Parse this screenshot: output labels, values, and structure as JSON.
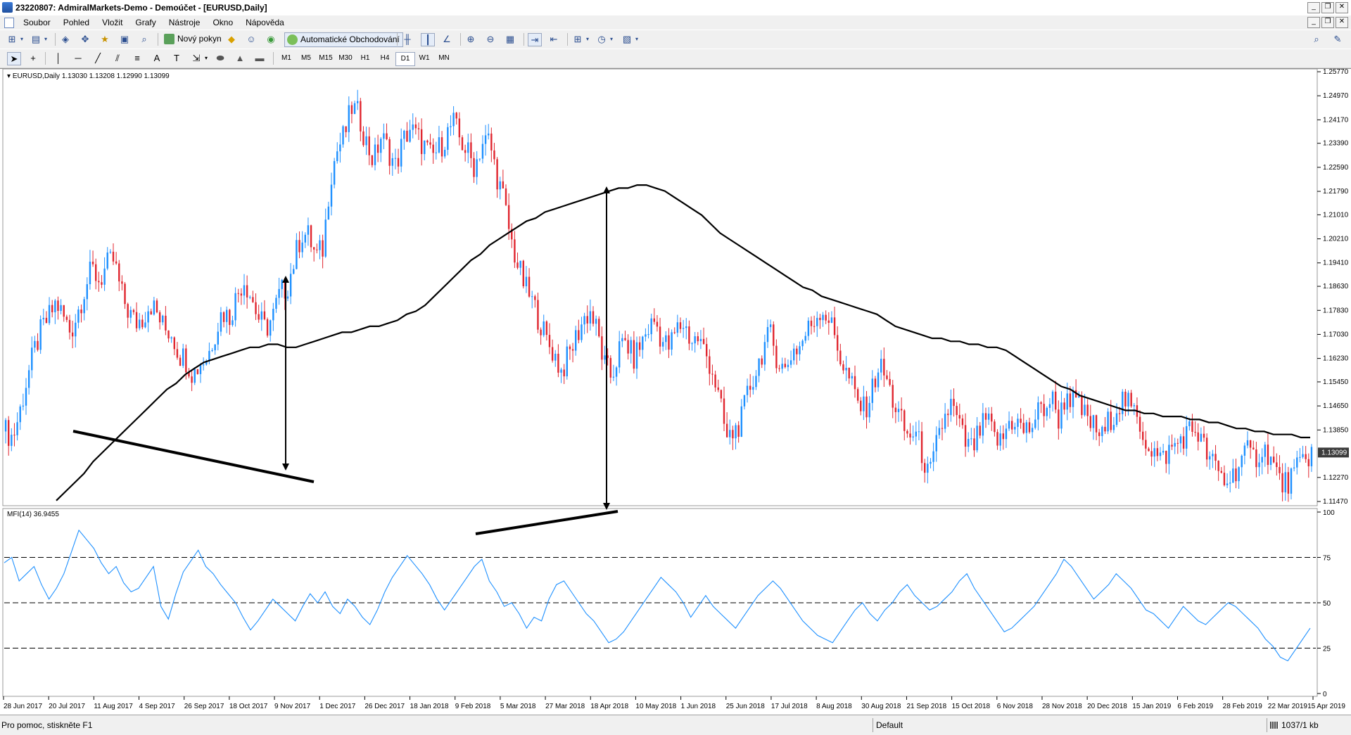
{
  "window": {
    "title": "23220807: AdmiralMarkets-Demo - Demoúčet - [EURUSD,Daily]"
  },
  "menu": [
    "Soubor",
    "Pohled",
    "Vložit",
    "Grafy",
    "Nástroje",
    "Okno",
    "Nápověda"
  ],
  "toolbar": {
    "new_order_label": "Nový pokyn",
    "auto_trading_label": "Automatické Obchodování"
  },
  "timeframes": [
    "M1",
    "M5",
    "M15",
    "M30",
    "H1",
    "H4",
    "D1",
    "W1",
    "MN"
  ],
  "active_timeframe": "D1",
  "chart_data": [
    {
      "type": "candlestick",
      "title": "EURUSD,Daily  1.13030 1.13208 1.12990 1.13099",
      "symbol": "EURUSD",
      "timeframe": "Daily",
      "ohlc_header": {
        "open": 1.1303,
        "high": 1.13208,
        "low": 1.1299,
        "close": 1.13099
      },
      "current_price": "1.13099",
      "y_ticks": [
        "1.25770",
        "1.24970",
        "1.24170",
        "1.23390",
        "1.22590",
        "1.21790",
        "1.21010",
        "1.20210",
        "1.19410",
        "1.18630",
        "1.17830",
        "1.17030",
        "1.16230",
        "1.15450",
        "1.14650",
        "1.13850",
        "1.12270",
        "1.11470"
      ],
      "ylim": [
        1.1147,
        1.2577
      ],
      "x_ticks": [
        "28 Jun 2017",
        "20 Jul 2017",
        "11 Aug 2017",
        "4 Sep 2017",
        "26 Sep 2017",
        "18 Oct 2017",
        "9 Nov 2017",
        "1 Dec 2017",
        "26 Dec 2017",
        "18 Jan 2018",
        "9 Feb 2018",
        "5 Mar 2018",
        "27 Mar 2018",
        "18 Apr 2018",
        "10 May 2018",
        "1 Jun 2018",
        "25 Jun 2018",
        "17 Jul 2018",
        "8 Aug 2018",
        "30 Aug 2018",
        "21 Sep 2018",
        "15 Oct 2018",
        "6 Nov 2018",
        "28 Nov 2018",
        "20 Dec 2018",
        "15 Jan 2019",
        "6 Feb 2019",
        "28 Feb 2019",
        "22 Mar 2019",
        "15 Apr 2019"
      ],
      "close_path": [
        1.138,
        1.136,
        1.145,
        1.156,
        1.165,
        1.172,
        1.176,
        1.181,
        1.176,
        1.171,
        1.178,
        1.186,
        1.192,
        1.188,
        1.193,
        1.195,
        1.184,
        1.178,
        1.174,
        1.176,
        1.181,
        1.177,
        1.172,
        1.171,
        1.164,
        1.162,
        1.157,
        1.161,
        1.163,
        1.171,
        1.178,
        1.176,
        1.183,
        1.189,
        1.183,
        1.176,
        1.172,
        1.176,
        1.184,
        1.186,
        1.195,
        1.204,
        1.203,
        1.196,
        1.199,
        1.223,
        1.232,
        1.237,
        1.246,
        1.243,
        1.234,
        1.228,
        1.236,
        1.232,
        1.226,
        1.234,
        1.239,
        1.236,
        1.233,
        1.229,
        1.232,
        1.236,
        1.241,
        1.235,
        1.231,
        1.226,
        1.234,
        1.235,
        1.224,
        1.215,
        1.202,
        1.193,
        1.186,
        1.181,
        1.175,
        1.168,
        1.164,
        1.158,
        1.163,
        1.169,
        1.175,
        1.178,
        1.171,
        1.16,
        1.156,
        1.165,
        1.168,
        1.162,
        1.167,
        1.172,
        1.175,
        1.168,
        1.166,
        1.172,
        1.174,
        1.168,
        1.169,
        1.164,
        1.158,
        1.147,
        1.135,
        1.138,
        1.142,
        1.152,
        1.158,
        1.166,
        1.17,
        1.162,
        1.158,
        1.165,
        1.166,
        1.171,
        1.175,
        1.179,
        1.176,
        1.169,
        1.16,
        1.155,
        1.148,
        1.145,
        1.151,
        1.16,
        1.156,
        1.148,
        1.142,
        1.136,
        1.138,
        1.131,
        1.122,
        1.133,
        1.142,
        1.147,
        1.141,
        1.134,
        1.132,
        1.138,
        1.142,
        1.136,
        1.134,
        1.141,
        1.142,
        1.138,
        1.139,
        1.144,
        1.146,
        1.149,
        1.142,
        1.151,
        1.148,
        1.145,
        1.142,
        1.139,
        1.136,
        1.142,
        1.146,
        1.149,
        1.145,
        1.142,
        1.135,
        1.132,
        1.128,
        1.131,
        1.133,
        1.136,
        1.138,
        1.139,
        1.133,
        1.128,
        1.125,
        1.121,
        1.123,
        1.128,
        1.131,
        1.129,
        1.132,
        1.131,
        1.125,
        1.12,
        1.122,
        1.125,
        1.129,
        1.131
      ],
      "moving_average": [
        1.115,
        1.118,
        1.121,
        1.124,
        1.128,
        1.131,
        1.134,
        1.137,
        1.14,
        1.143,
        1.146,
        1.149,
        1.152,
        1.154,
        1.157,
        1.159,
        1.161,
        1.162,
        1.163,
        1.164,
        1.165,
        1.166,
        1.166,
        1.167,
        1.167,
        1.166,
        1.166,
        1.167,
        1.168,
        1.169,
        1.17,
        1.171,
        1.171,
        1.172,
        1.173,
        1.173,
        1.174,
        1.175,
        1.177,
        1.178,
        1.18,
        1.183,
        1.186,
        1.189,
        1.192,
        1.195,
        1.197,
        1.2,
        1.202,
        1.204,
        1.206,
        1.208,
        1.209,
        1.211,
        1.212,
        1.213,
        1.214,
        1.215,
        1.216,
        1.217,
        1.218,
        1.219,
        1.219,
        1.22,
        1.22,
        1.219,
        1.218,
        1.216,
        1.214,
        1.212,
        1.21,
        1.207,
        1.204,
        1.202,
        1.2,
        1.198,
        1.196,
        1.194,
        1.192,
        1.19,
        1.188,
        1.186,
        1.185,
        1.183,
        1.182,
        1.181,
        1.18,
        1.179,
        1.178,
        1.177,
        1.175,
        1.173,
        1.172,
        1.171,
        1.17,
        1.169,
        1.169,
        1.168,
        1.168,
        1.167,
        1.167,
        1.166,
        1.166,
        1.165,
        1.163,
        1.161,
        1.159,
        1.157,
        1.155,
        1.153,
        1.152,
        1.15,
        1.149,
        1.148,
        1.147,
        1.146,
        1.145,
        1.145,
        1.144,
        1.144,
        1.143,
        1.143,
        1.143,
        1.142,
        1.142,
        1.141,
        1.141,
        1.14,
        1.139,
        1.139,
        1.138,
        1.138,
        1.137,
        1.137,
        1.137,
        1.136,
        1.136
      ]
    },
    {
      "type": "line",
      "title": "MFI(14) 36.9455",
      "indicator": "MFI(14)",
      "current_value": 36.9455,
      "ylim": [
        0,
        100
      ],
      "y_ticks": [
        "100",
        "75",
        "50",
        "25",
        "0"
      ],
      "levels": [
        75,
        50,
        25
      ],
      "series": [
        {
          "values": [
            72,
            75,
            62,
            66,
            70,
            60,
            52,
            58,
            66,
            78,
            90,
            85,
            80,
            72,
            66,
            70,
            61,
            56,
            58,
            64,
            70,
            48,
            41,
            55,
            67,
            73,
            79,
            70,
            66,
            60,
            55,
            50,
            42,
            35,
            40,
            46,
            52,
            48,
            44,
            40,
            48,
            55,
            50,
            56,
            48,
            44,
            52,
            48,
            42,
            38,
            46,
            56,
            64,
            70,
            76,
            71,
            66,
            60,
            52,
            46,
            52,
            58,
            64,
            70,
            74,
            62,
            56,
            48,
            50,
            44,
            36,
            42,
            40,
            52,
            60,
            62,
            56,
            50,
            44,
            40,
            34,
            28,
            30,
            34,
            40,
            46,
            52,
            58,
            64,
            60,
            56,
            50,
            42,
            48,
            54,
            48,
            44,
            40,
            36,
            42,
            48,
            54,
            58,
            62,
            58,
            52,
            46,
            40,
            36,
            32,
            30,
            28,
            34,
            40,
            46,
            50,
            44,
            40,
            46,
            50,
            56,
            60,
            54,
            50,
            46,
            48,
            52,
            56,
            62,
            66,
            58,
            52,
            46,
            40,
            34,
            36,
            40,
            44,
            48,
            54,
            60,
            66,
            74,
            70,
            64,
            58,
            52,
            56,
            60,
            66,
            62,
            58,
            52,
            46,
            44,
            40,
            36,
            42,
            48,
            44,
            40,
            38,
            42,
            46,
            50,
            48,
            44,
            40,
            36,
            30,
            26,
            20,
            18,
            24,
            30,
            36
          ]
        }
      ]
    }
  ],
  "status": {
    "help": "Pro pomoc, stiskněte F1",
    "profile": "Default",
    "traffic": "1037/1 kb"
  }
}
